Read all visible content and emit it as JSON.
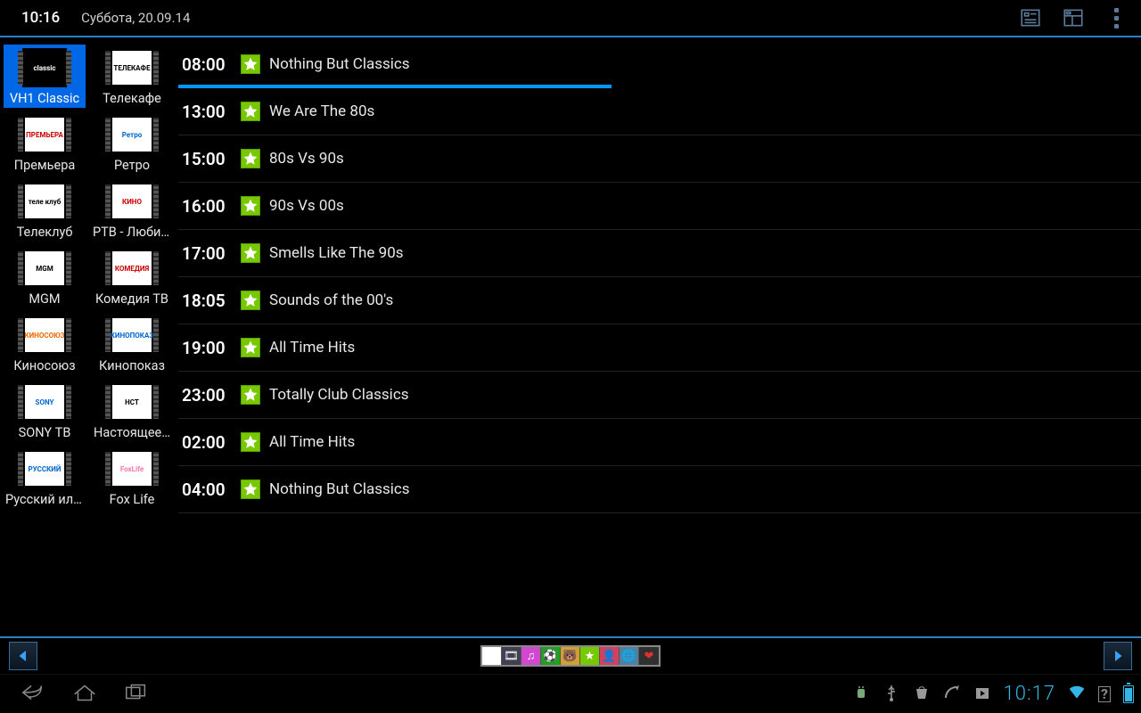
{
  "header": {
    "time": "10:16",
    "date": "Суббота, 20.09.14"
  },
  "channels": [
    {
      "label": "VH1 Classic",
      "logo_text": "classic",
      "logo_class": "lg-black",
      "selected": true
    },
    {
      "label": "Телекафе",
      "logo_text": "ТЕЛЕКАФЕ",
      "logo_class": ""
    },
    {
      "label": "Премьера",
      "logo_text": "ПРЕМЬЕРА",
      "logo_class": "lg-red"
    },
    {
      "label": "Ретро",
      "logo_text": "Ретро",
      "logo_class": "lg-blue"
    },
    {
      "label": "Телеклуб",
      "logo_text": "теле клуб",
      "logo_class": ""
    },
    {
      "label": "РТВ - Любимое кино",
      "logo_text": "КИНО",
      "logo_class": "lg-red"
    },
    {
      "label": "MGM",
      "logo_text": "MGM",
      "logo_class": ""
    },
    {
      "label": "Комедия ТВ",
      "logo_text": "КОМЕДИЯ",
      "logo_class": "lg-red"
    },
    {
      "label": "Киносоюз",
      "logo_text": "КИНОСОЮЗ",
      "logo_class": "lg-orange"
    },
    {
      "label": "Кинопоказ",
      "logo_text": "КИНОПОКАЗ",
      "logo_class": "lg-blue"
    },
    {
      "label": "SONY ТВ",
      "logo_text": "SONY",
      "logo_class": "lg-blue"
    },
    {
      "label": "Настоящее…",
      "logo_text": "НСТ",
      "logo_class": ""
    },
    {
      "label": "Русский иллюзион",
      "logo_text": "РУССКИЙ",
      "logo_class": "lg-blue"
    },
    {
      "label": "Fox Life",
      "logo_text": "FoxLife",
      "logo_class": "lg-fox"
    }
  ],
  "programmes": [
    {
      "time": "08:00",
      "title": "Nothing But Classics",
      "current": true,
      "progress_pct": 45
    },
    {
      "time": "13:00",
      "title": "We Are The 80s"
    },
    {
      "time": "15:00",
      "title": "80s Vs 90s"
    },
    {
      "time": "16:00",
      "title": "90s Vs 00s"
    },
    {
      "time": "17:00",
      "title": "Smells Like The 90s"
    },
    {
      "time": "18:05",
      "title": "Sounds of the 00's"
    },
    {
      "time": "19:00",
      "title": "All Time Hits"
    },
    {
      "time": "23:00",
      "title": "Totally Club Classics"
    },
    {
      "time": "02:00",
      "title": "All Time Hits"
    },
    {
      "time": "04:00",
      "title": "Nothing But Classics"
    }
  ],
  "filters": [
    {
      "bg": "#ffffff",
      "glyph": "",
      "fg": "#000"
    },
    {
      "bg": "#404050",
      "glyph": "🎞",
      "fg": "#fff"
    },
    {
      "bg": "#d048d0",
      "glyph": "♫",
      "fg": "#fff"
    },
    {
      "bg": "#20a020",
      "glyph": "⚽",
      "fg": "#fff"
    },
    {
      "bg": "#d0a030",
      "glyph": "🐻",
      "fg": "#fff"
    },
    {
      "bg": "#78c800",
      "glyph": "★",
      "fg": "#fff"
    },
    {
      "bg": "#d04060",
      "glyph": "👤",
      "fg": "#fff"
    },
    {
      "bg": "#5080a0",
      "glyph": "🌐",
      "fg": "#fff"
    },
    {
      "bg": "#303030",
      "glyph": "❤",
      "fg": "#e03030"
    }
  ],
  "navbar": {
    "clock": "10:17"
  }
}
